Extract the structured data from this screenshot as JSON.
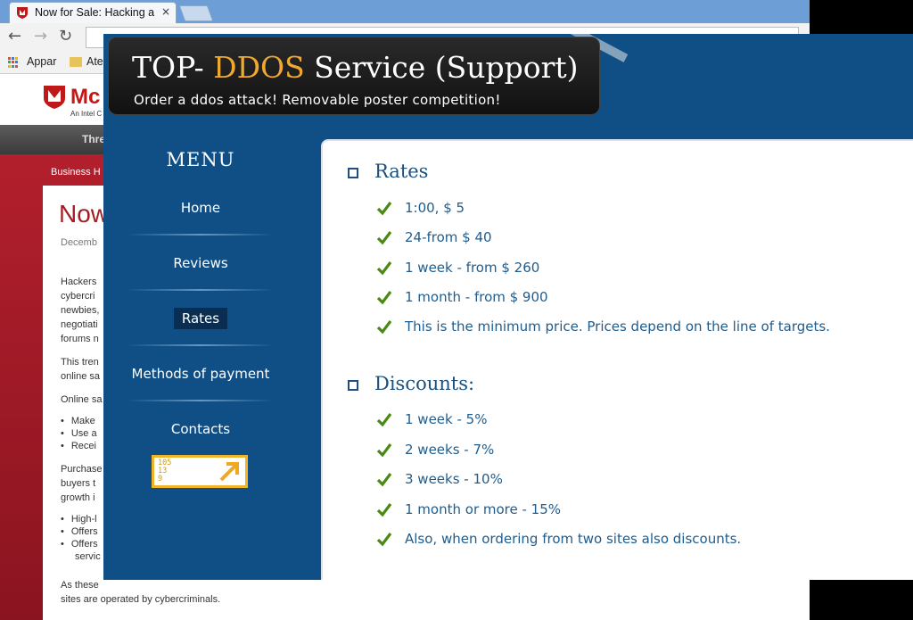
{
  "browser": {
    "tab_title": "Now for Sale: Hacking a",
    "tab_close": "×",
    "bookmarks": [
      "Appar",
      "Ate"
    ]
  },
  "mcafee": {
    "logo_text": "Mc",
    "logo_sub": "An Intel C",
    "nav_item": "Thre",
    "breadcrumb": "Business H",
    "heading": "Now",
    "date": "Decemb",
    "paragraphs": [
      "Hackers",
      "cybercri",
      "newbies,",
      "negotiati",
      "forums n",
      "This tren",
      "online sa",
      "Online sa"
    ],
    "bullets_a": [
      "Make",
      "Use a",
      "Recei"
    ],
    "paragraphs_b": [
      "Purchase",
      "buyers t",
      "growth i"
    ],
    "bullets_b": [
      "High-l",
      "Offers",
      "Offers"
    ],
    "bullet_b_cont": "servic",
    "footer_line1": "As these",
    "footer_line2": "sites are operated by cybercriminals."
  },
  "ddos": {
    "title_pre": "TOP- ",
    "title_accent": "DDOS",
    "title_post": " Service (Support)",
    "subtitle": "Order a ddos attack! Removable poster competition!",
    "menu_title": "MENU",
    "menu": [
      "Home",
      "Reviews",
      "Rates",
      "Methods of payment",
      "Contacts"
    ],
    "active_menu": "Rates",
    "counter_lines": "105\n13\n9",
    "rates_title": "Rates",
    "rates": [
      "1:00, $ 5",
      "24-from $ 40",
      "1 week - from $ 260",
      "1 month - from $ 900",
      "This is the minimum price. Prices depend on the line of targets."
    ],
    "discounts_title": "Discounts:",
    "discounts": [
      "1 week - 5%",
      "2 weeks - 7%",
      "3 weeks - 10%",
      "1 month or more - 15%",
      "Also, when ordering from two sites also discounts."
    ]
  },
  "colors": {
    "overlay_bg": "#0f4f86",
    "accent": "#f0a830",
    "check": "#4a8a12",
    "text_blue": "#1f5c8e",
    "mcafee_red": "#b21f2c"
  }
}
